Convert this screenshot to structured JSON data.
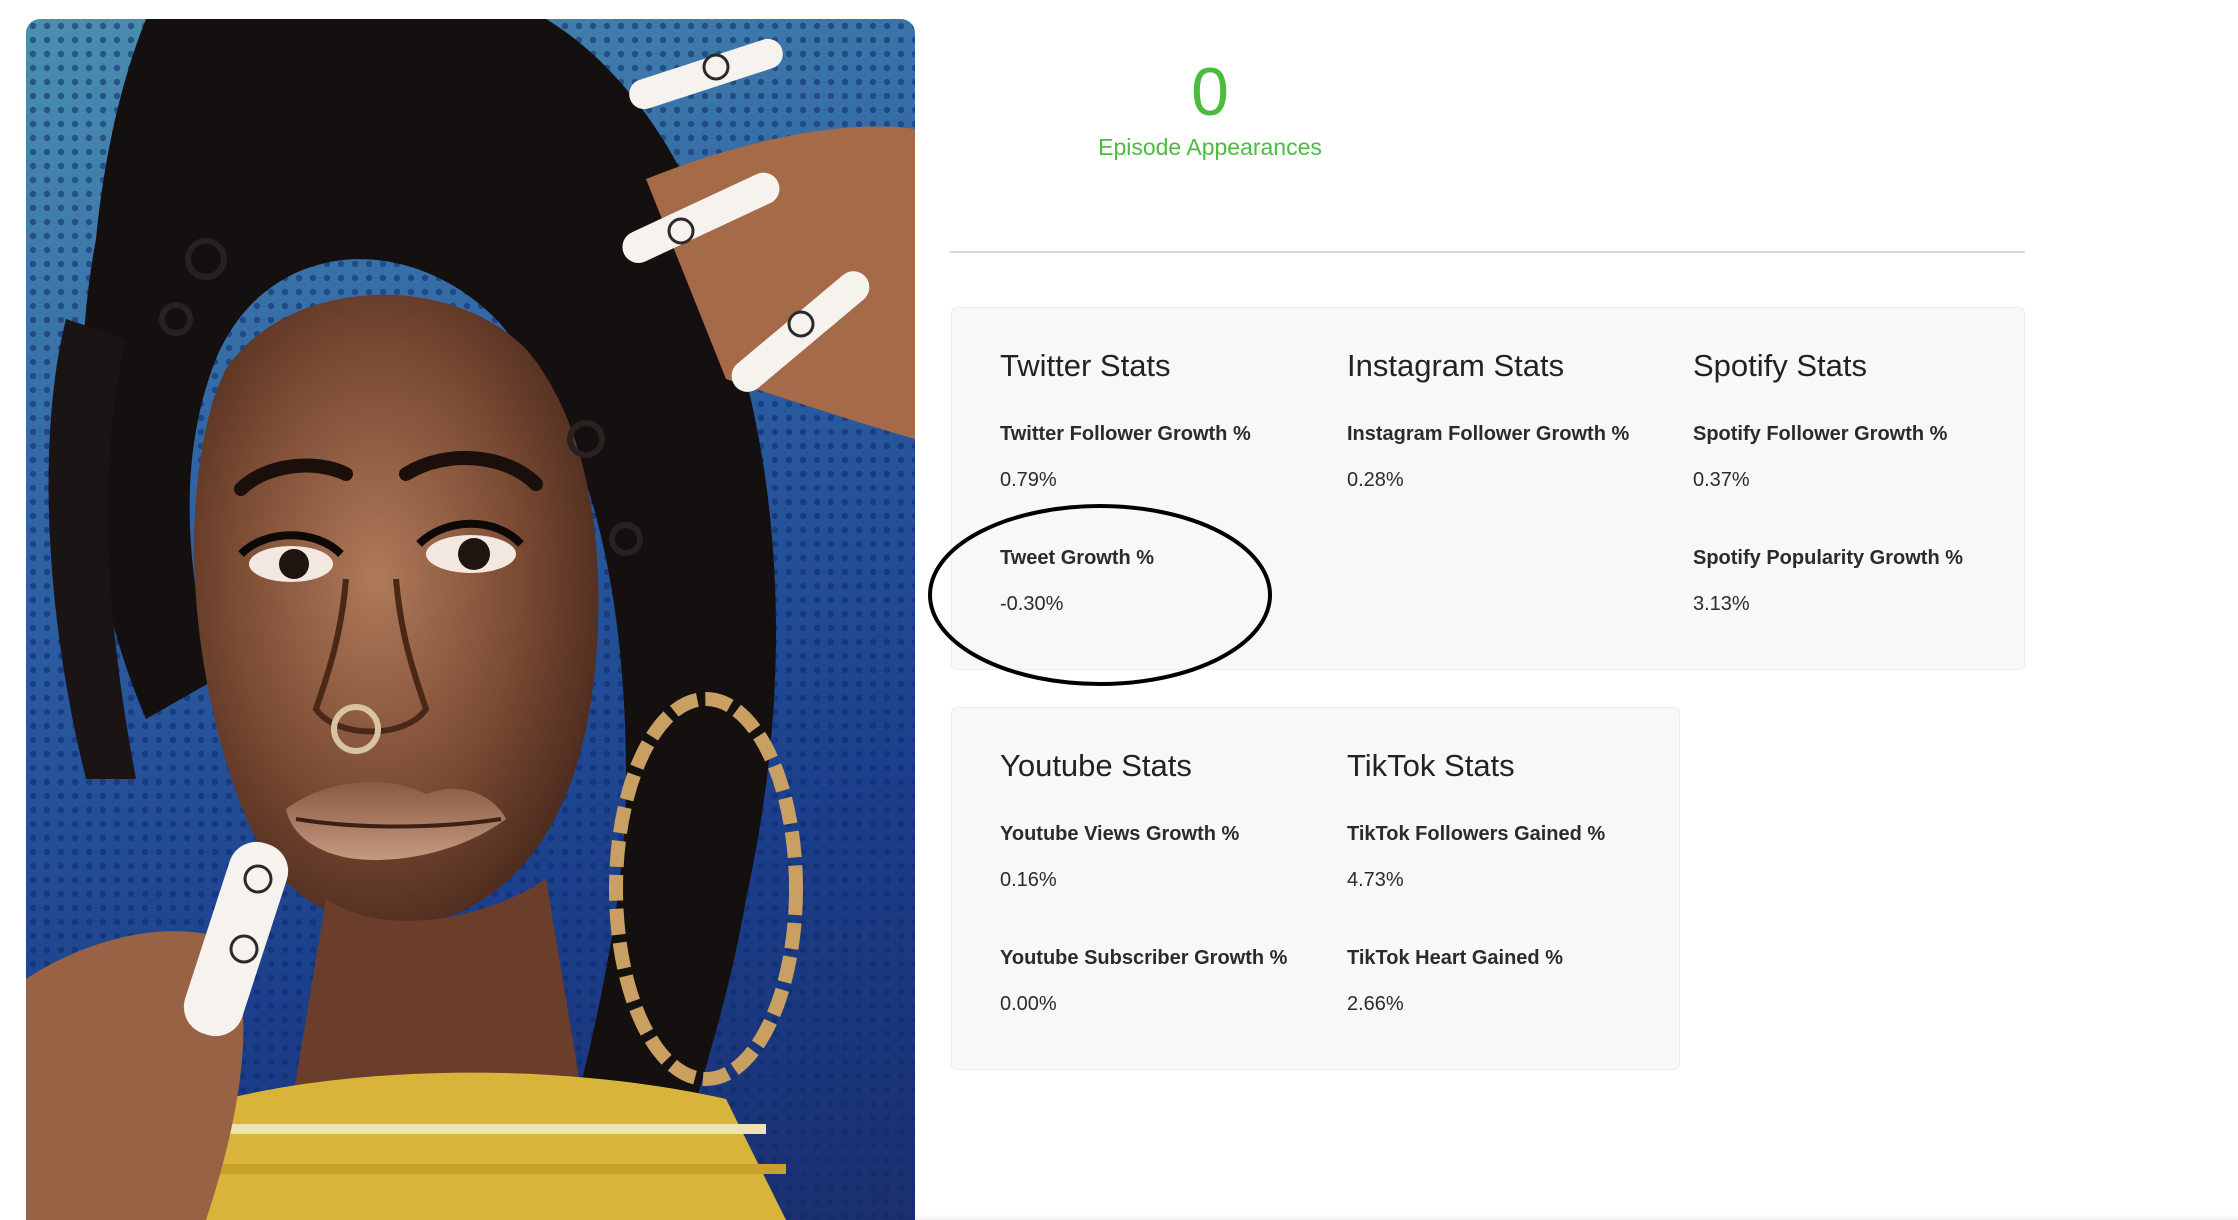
{
  "episodes": {
    "count": "0",
    "label": "Episode Appearances"
  },
  "accent_color": "#4cbb3f",
  "portrait": {
    "icon": "artist-photo"
  },
  "twitter": {
    "title": "Twitter Stats",
    "follower_growth_label": "Twitter Follower Growth %",
    "follower_growth_value": "0.79%",
    "tweet_growth_label": "Tweet Growth %",
    "tweet_growth_value": "-0.30%"
  },
  "instagram": {
    "title": "Instagram Stats",
    "follower_growth_label": "Instagram Follower Growth %",
    "follower_growth_value": "0.28%"
  },
  "spotify": {
    "title": "Spotify Stats",
    "follower_growth_label": "Spotify Follower Growth %",
    "follower_growth_value": "0.37%",
    "popularity_growth_label": "Spotify Popularity Growth %",
    "popularity_growth_value": "3.13%"
  },
  "youtube": {
    "title": "Youtube Stats",
    "views_growth_label": "Youtube Views Growth %",
    "views_growth_value": "0.16%",
    "subscriber_growth_label": "Youtube Subscriber Growth %",
    "subscriber_growth_value": "0.00%"
  },
  "tiktok": {
    "title": "TikTok Stats",
    "followers_gained_label": "TikTok Followers Gained %",
    "followers_gained_value": "4.73%",
    "heart_gained_label": "TikTok Heart Gained %",
    "heart_gained_value": "2.66%"
  }
}
